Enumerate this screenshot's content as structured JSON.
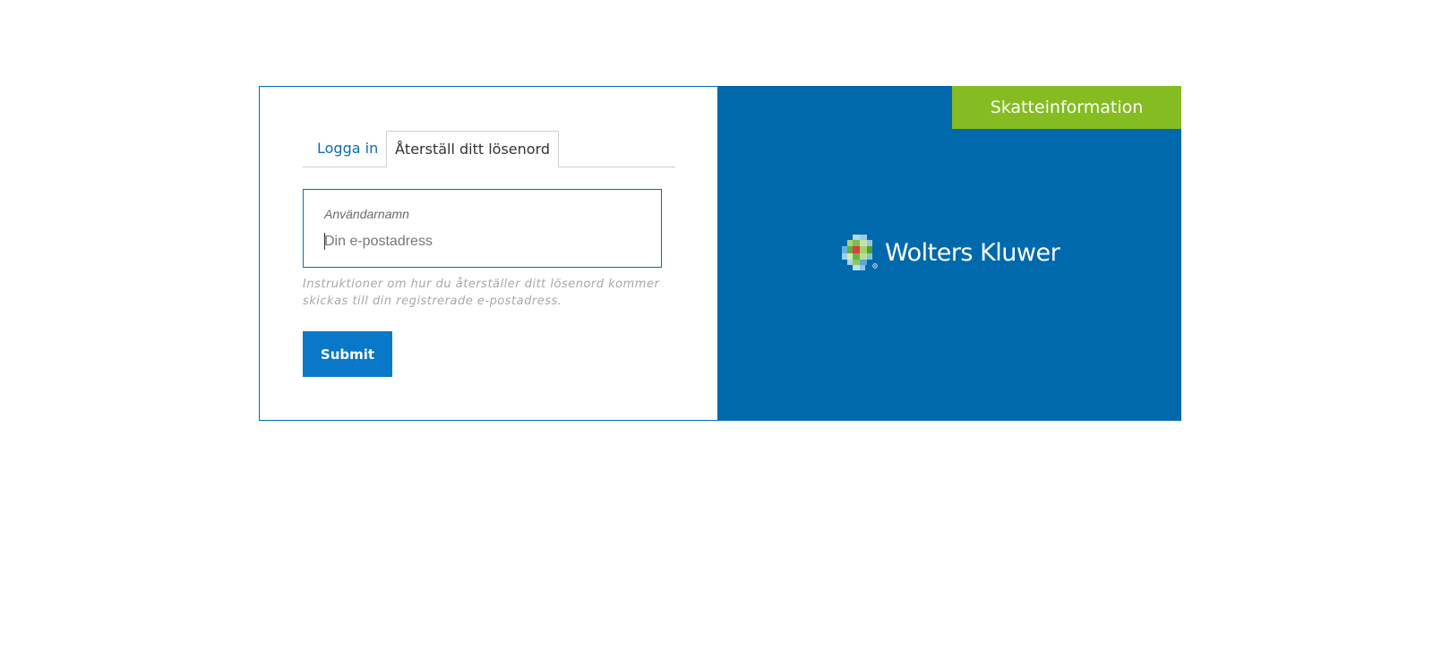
{
  "tabs": {
    "login": "Logga in",
    "reset": "Återställ ditt lösenord"
  },
  "form": {
    "username_label": "Användarnamn",
    "username_placeholder": "Din e-postadress",
    "username_value": "",
    "help_text": "Instruktioner om hur du återställer ditt lösenord kommer skickas till din registrerade e-postadress.",
    "submit_label": "Submit"
  },
  "brand": {
    "product_tab": "Skatteinformation",
    "logo_text": "Wolters Kluwer"
  },
  "colors": {
    "brand_blue": "#0069ac",
    "accent_green": "#85bc22",
    "button_blue": "#0a78c8",
    "link_blue": "#0a6db1"
  }
}
